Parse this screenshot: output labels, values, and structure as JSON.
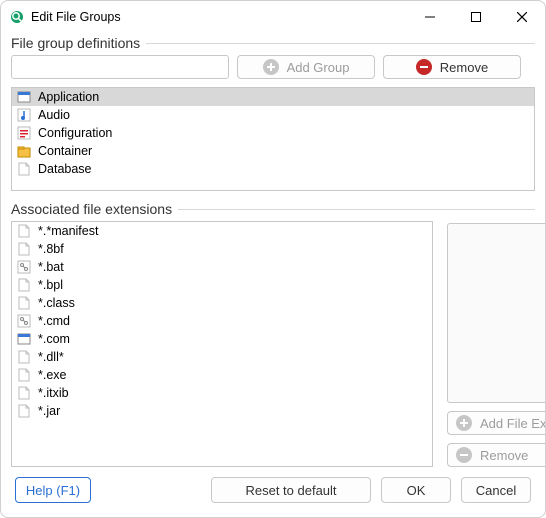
{
  "window": {
    "title": "Edit File Groups"
  },
  "sections": {
    "groups_label": "File group definitions",
    "extensions_label": "Associated file extensions"
  },
  "groups": {
    "input_value": "",
    "add_label": "Add Group",
    "remove_label": "Remove",
    "items": [
      {
        "label": "Application",
        "icon": "app-window",
        "selected": true
      },
      {
        "label": "Audio",
        "icon": "audio",
        "selected": false
      },
      {
        "label": "Configuration",
        "icon": "config",
        "selected": false
      },
      {
        "label": "Container",
        "icon": "container",
        "selected": false
      },
      {
        "label": "Database",
        "icon": "file",
        "selected": false
      }
    ]
  },
  "extensions": {
    "input_value": "",
    "add_label": "Add File Extension",
    "remove_label": "Remove",
    "items": [
      {
        "label": "*.*manifest",
        "icon": "file"
      },
      {
        "label": "*.8bf",
        "icon": "file"
      },
      {
        "label": "*.bat",
        "icon": "cmd"
      },
      {
        "label": "*.bpl",
        "icon": "file"
      },
      {
        "label": "*.class",
        "icon": "file"
      },
      {
        "label": "*.cmd",
        "icon": "cmd"
      },
      {
        "label": "*.com",
        "icon": "app-window"
      },
      {
        "label": "*.dll*",
        "icon": "file"
      },
      {
        "label": "*.exe",
        "icon": "file"
      },
      {
        "label": "*.itxib",
        "icon": "file"
      },
      {
        "label": "*.jar",
        "icon": "file"
      }
    ]
  },
  "footer": {
    "help": "Help (F1)",
    "reset": "Reset to default",
    "ok": "OK",
    "cancel": "Cancel"
  },
  "colors": {
    "accent_remove": "#c62828",
    "accent_blue": "#2a6fd6"
  }
}
